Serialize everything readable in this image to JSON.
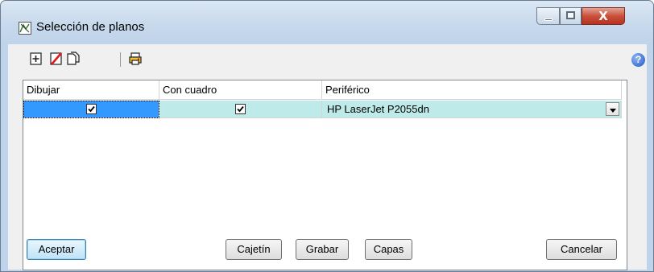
{
  "window": {
    "title": "Selección de planos",
    "close_symbol": "X",
    "help_symbol": "?"
  },
  "toolbar": {
    "icons": [
      "add-plan-icon",
      "delete-plan-icon",
      "copy-page-icon",
      "print-icon"
    ]
  },
  "grid": {
    "columns": [
      "Dibujar",
      "Con cuadro",
      "Periférico"
    ],
    "rows": [
      {
        "dibujar": true,
        "con_cuadro": true,
        "periferico": "HP LaserJet P2055dn"
      }
    ]
  },
  "buttons": {
    "accept": "Aceptar",
    "cajetin": "Cajetín",
    "grabar": "Grabar",
    "capas": "Capas",
    "cancel": "Cancelar"
  },
  "colors": {
    "selected_row": "#bfeaea",
    "focus_cell": "#3399ff",
    "close_button": "#c9503b"
  }
}
